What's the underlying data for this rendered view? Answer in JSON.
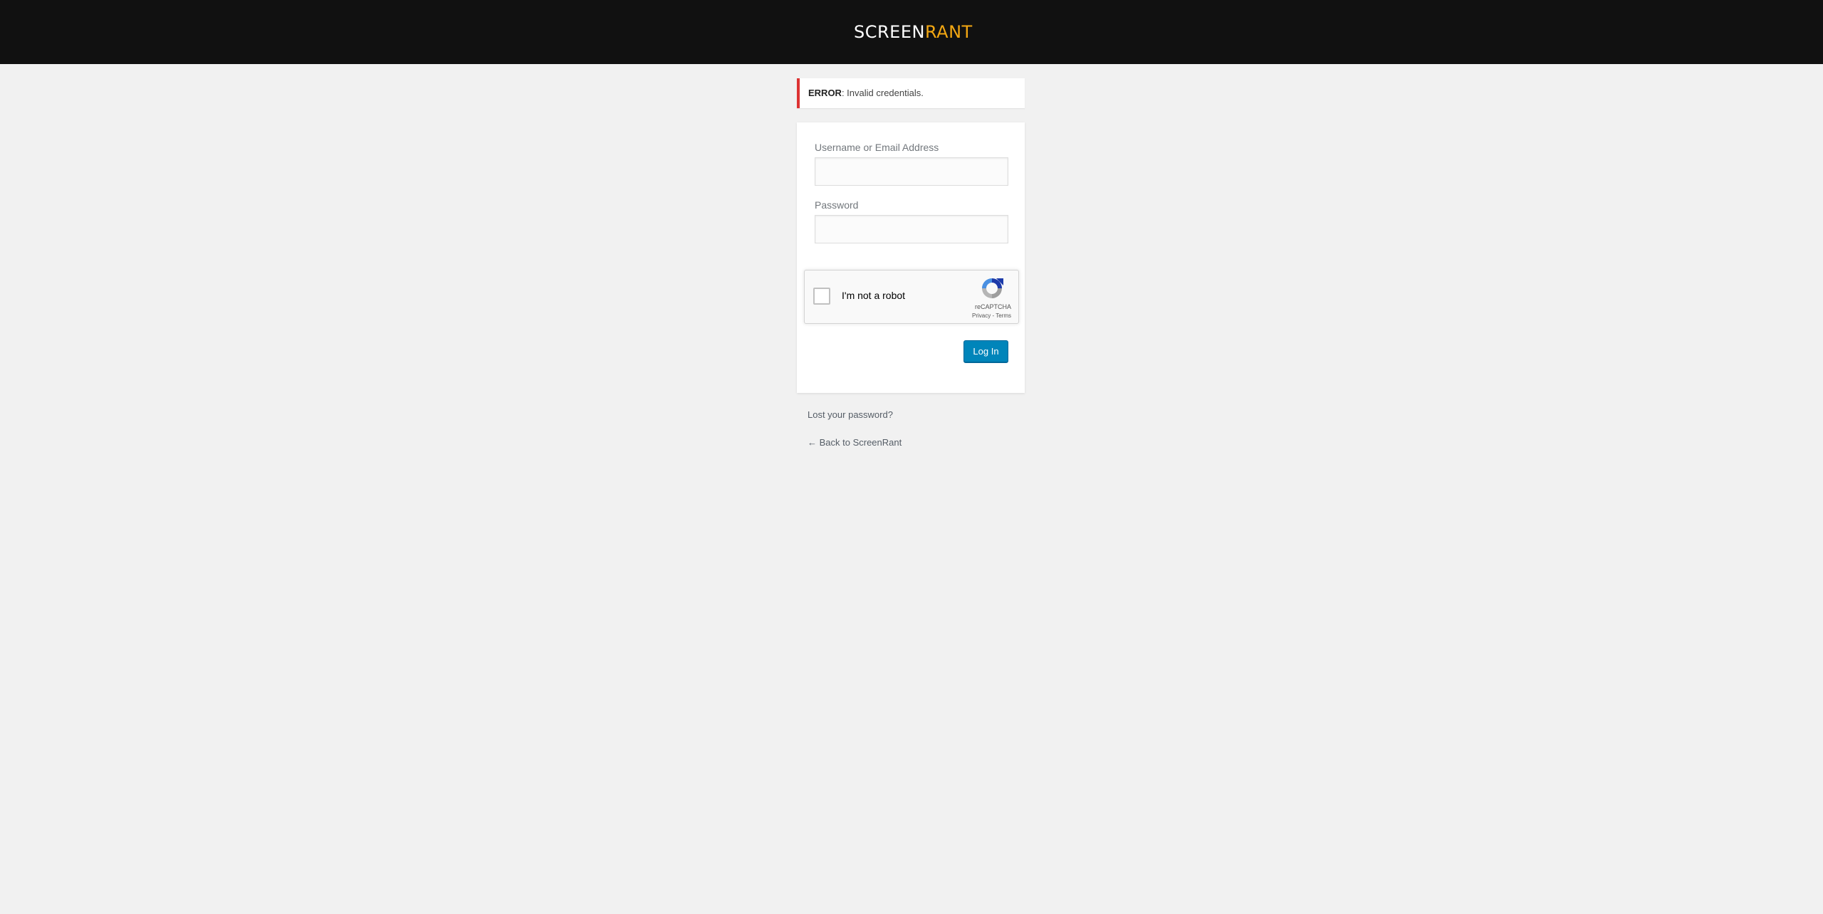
{
  "header": {
    "logo_part1": "SCREEN",
    "logo_part2": "RANT",
    "background_color": "#111111",
    "accent_color": "#f3a712"
  },
  "error": {
    "label": "ERROR",
    "message": ": Invalid credentials.",
    "border_color": "#dc3232"
  },
  "form": {
    "username_label": "Username or Email Address",
    "username_value": "",
    "password_label": "Password",
    "password_value": "",
    "recaptcha": {
      "checkbox_label": "I'm not a robot",
      "brand": "reCAPTCHA",
      "privacy": "Privacy",
      "separator": " - ",
      "terms": "Terms",
      "icon": "recaptcha-logo-icon"
    },
    "submit_label": "Log In",
    "button_color": "#0085ba"
  },
  "links": {
    "lost_password": "Lost your password?",
    "back": "← Back to ScreenRant"
  }
}
